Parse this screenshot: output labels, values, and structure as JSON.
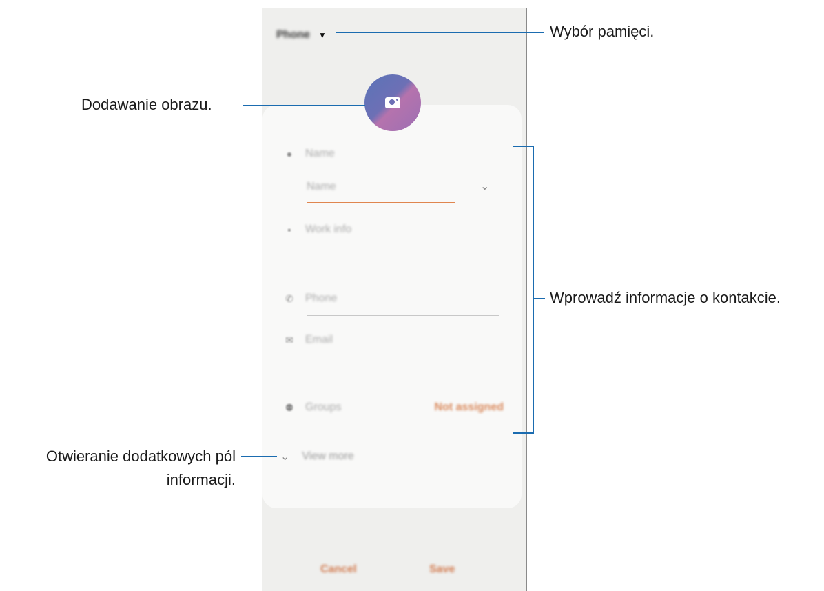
{
  "screen": {
    "storage_label": "Phone",
    "fields": {
      "name_header": "Name",
      "name_input_placeholder": "Name",
      "work_info": "Work info",
      "phone": "Phone",
      "email": "Email",
      "groups": "Groups",
      "groups_value": "Not assigned",
      "view_more": "View more"
    },
    "buttons": {
      "cancel": "Cancel",
      "save": "Save"
    }
  },
  "annotations": {
    "storage": "Wybór pamięci.",
    "add_image": "Dodawanie obrazu.",
    "enter_info": "Wprowadź informacje o kontakcie.",
    "more_fields_line1": "Otwieranie dodatkowych pól",
    "more_fields_line2": "informacji."
  },
  "colors": {
    "accent_line": "#1b6cb0",
    "orange": "#e0864f"
  }
}
